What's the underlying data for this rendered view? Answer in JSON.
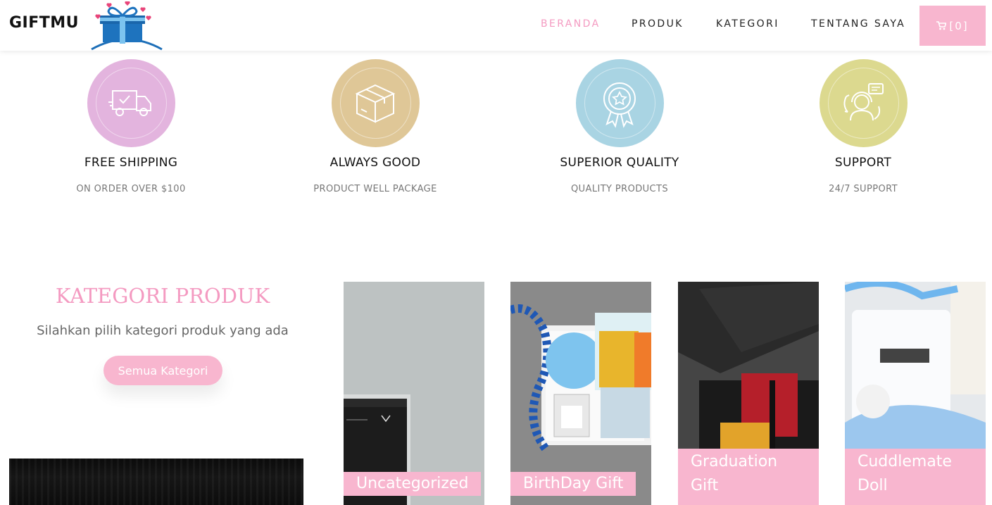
{
  "header": {
    "brand": "GIFTMU",
    "nav": [
      "BERANDA",
      "PRODUK",
      "KATEGORI",
      "TENTANG SAYA"
    ],
    "cart_label": "[0]"
  },
  "features": [
    {
      "title": "FREE SHIPPING",
      "subtitle": "ON ORDER OVER $100",
      "color": "#e3b4de",
      "icon": "truck-icon"
    },
    {
      "title": "ALWAYS GOOD",
      "subtitle": "PRODUCT WELL PACKAGE",
      "color": "#dfc797",
      "icon": "box-icon"
    },
    {
      "title": "SUPERIOR QUALITY",
      "subtitle": "QUALITY PRODUCTS",
      "color": "#a9d4e3",
      "icon": "badge-star-icon"
    },
    {
      "title": "SUPPORT",
      "subtitle": "24/7 SUPPORT",
      "color": "#dcd98f",
      "icon": "headset-icon"
    }
  ],
  "kategori": {
    "title": "KATEGORI PRODUK",
    "subtitle": "Silahkan pilih kategori produk yang ada",
    "button": "Semua Kategori"
  },
  "cards": [
    {
      "label": "Uncategorized"
    },
    {
      "label": "BirthDay Gift"
    },
    {
      "label_line1": "Graduation",
      "label_line2": "Gift"
    },
    {
      "label_line1": "Cuddlemate",
      "label_line2": "Doll"
    }
  ],
  "colors": {
    "accent": "#f49ac1",
    "accent_bg": "#f8b6cf"
  }
}
